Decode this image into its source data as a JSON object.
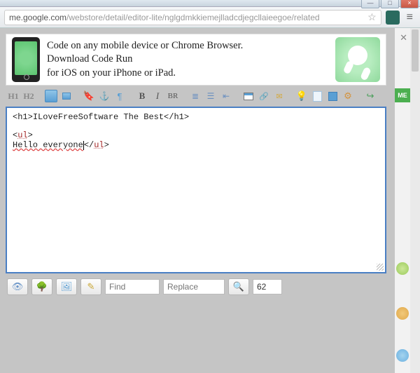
{
  "browser": {
    "url_prefix": "me.google.com",
    "url_path": "/webstore/detail/editor-lite/nglgdmkkiemejlladcdjegcllaieegoe/related"
  },
  "side": {
    "me_label": "ME"
  },
  "banner": {
    "line1": "Code on any mobile device or Chrome Browser.",
    "line2": "Download Code Run",
    "line3": "for iOS on your iPhone or iPad."
  },
  "toolbar": {
    "h1": "H1",
    "h2": "H2",
    "bold": "B",
    "italic": "I",
    "br": "BR"
  },
  "editor": {
    "l1_open": "<h1>",
    "l1_text": "ILoveFreeSoftware The Best",
    "l1_close": "</h1>",
    "l2_open": "<",
    "l2_tag": "ul",
    "l2_close": ">",
    "l3_text": "Hello everyone",
    "l3_close_open": "</",
    "l3_close_tag": "ul",
    "l3_close_end": ">"
  },
  "bottom": {
    "find_ph": "Find",
    "replace_ph": "Replace",
    "count": "62"
  }
}
